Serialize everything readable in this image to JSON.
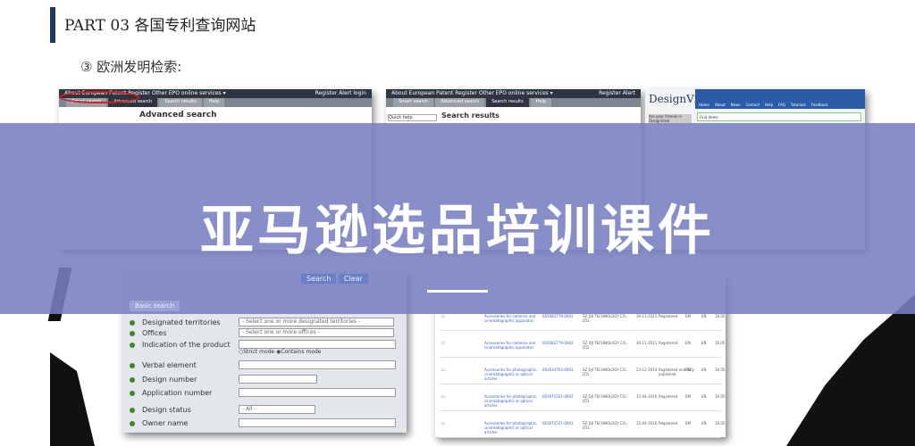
{
  "header": {
    "title": "PART 03   各国专利查询网站",
    "subtitle": "③ 欧洲发明检索:"
  },
  "banner": {
    "title": "亚马逊选品培训课件"
  },
  "epo_shot": {
    "nav_left": "About European Patent Register   Other EPO online services ▾",
    "nav_right": "Register Alert login",
    "tabs": [
      "Smart search",
      "Advanced search",
      "Search results",
      "Help"
    ],
    "title": "Advanced search"
  },
  "results_shot": {
    "nav_left": "About European Patent Register   Other EPO online services ▾",
    "nav_right": "Register Alert",
    "tabs": [
      "Smart search",
      "Advanced search",
      "Search results",
      "Help"
    ],
    "quick_help": "Quick help",
    "title": "Search results"
  },
  "designview": {
    "logo": "DesignView",
    "nav": [
      "Home",
      "About",
      "News",
      "Contact",
      "Help",
      "FAQ",
      "Tutorials",
      "Feedback"
    ],
    "find": "Find items",
    "side": "Are your friends in DesignView"
  },
  "form": {
    "buttons": [
      "Search",
      "Clear"
    ],
    "tab": "Basic search",
    "fields": [
      {
        "label": "Designated territories",
        "value": "- Select one or more designated territories -"
      },
      {
        "label": "Offices",
        "value": "- Select one or more offices -"
      },
      {
        "label": "Indication of the product",
        "value": ""
      },
      {
        "label": "Verbal element",
        "value": ""
      },
      {
        "label": "Design number",
        "value": ""
      },
      {
        "label": "Application number",
        "value": ""
      },
      {
        "label": "Design status",
        "value": "- All -"
      },
      {
        "label": "Owner name",
        "value": ""
      }
    ],
    "modes": [
      "Strict mode",
      "Contains mode"
    ]
  },
  "table": {
    "rows": [
      {
        "product": "Accessories for cameras and cinematographic apparatus",
        "number": "002082779-0001",
        "owner": "SZ DJI TECHNOLOGY CO., LTD.",
        "date": "30-11-2011",
        "status": "Registered",
        "office": "EM",
        "lang": "EN",
        "cls": "16.05"
      },
      {
        "product": "Accessories for cameras and cinematographic apparatus",
        "number": "002082779-0002",
        "owner": "SZ DJI TECHNOLOGY CO., LTD.",
        "date": "30-11-2011",
        "status": "Registered",
        "office": "EM",
        "lang": "EN",
        "cls": "16.05"
      },
      {
        "product": "Accessories for photographic, cinematographic or optical articles",
        "number": "002634793-0001",
        "owner": "SZ DJI TECHNOLOGY CO., LTD.",
        "date": "23-12-2014",
        "status": "Registered and fully published",
        "office": "EM",
        "lang": "EN",
        "cls": "16.05"
      },
      {
        "product": "Accessories for photographic, cinematographic or optical articles",
        "number": "003071521-0002",
        "owner": "SZ DJI TECHNOLOGY CO., LTD.",
        "date": "15-04-2016",
        "status": "Registered",
        "office": "EM",
        "lang": "EN",
        "cls": "16.05"
      },
      {
        "product": "Accessories for photographic, cinematographic or optical articles",
        "number": "003071521-0001",
        "owner": "SZ DJI TECHNOLOGY CO., LTD.",
        "date": "15-04-2016",
        "status": "Registered",
        "office": "EM",
        "lang": "EN",
        "cls": "16.05"
      }
    ]
  }
}
